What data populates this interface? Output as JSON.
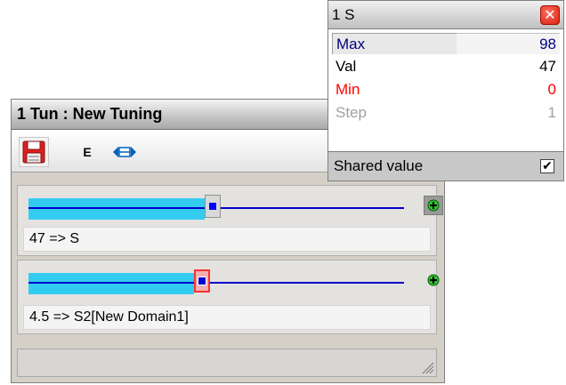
{
  "tuning_window": {
    "title": "1  Tun : New Tuning",
    "toolbar": {
      "save_icon": "floppy-disk-icon",
      "edit_label": "E",
      "expand_icon": "expand-horizontal-icon"
    },
    "parameters": [
      {
        "label": "47 => S",
        "value": 47,
        "min": 0,
        "max": 98,
        "plus_icon": "plus-icon"
      },
      {
        "label": "4.5 => S2[New Domain1]",
        "value_fraction": 0.47,
        "plus_icon": "plus-icon"
      }
    ]
  },
  "s_popup": {
    "title": "1  S",
    "close_icon": "close-icon",
    "rows": [
      {
        "label": "Max",
        "value": "98"
      },
      {
        "label": "Val",
        "value": "47"
      },
      {
        "label": "Min",
        "value": "0"
      },
      {
        "label": "Step",
        "value": "1"
      }
    ],
    "shared_label": "Shared value",
    "shared_checked": true,
    "shared_check_glyph": "✔"
  },
  "colors": {
    "slider_fill": "#33ccf0",
    "slider_track": "#0000cc",
    "max_color": "#000080",
    "min_color": "#ff0000",
    "step_color": "#a0a0a0"
  }
}
